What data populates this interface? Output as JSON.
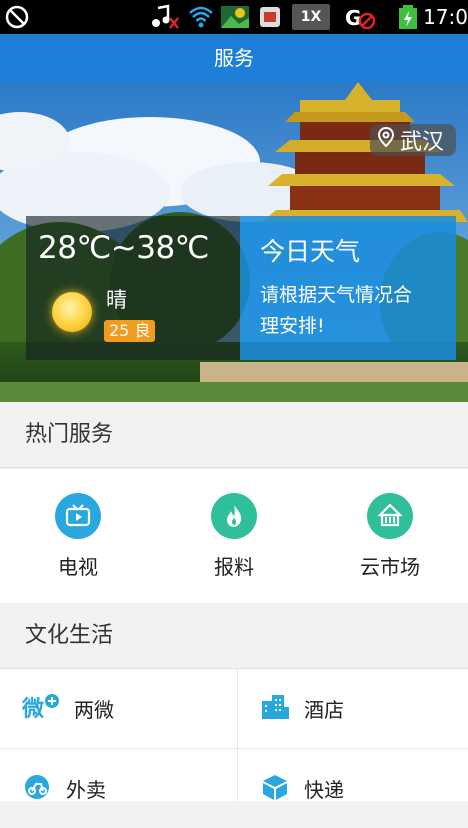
{
  "status_bar": {
    "time": "17:0",
    "multi_sim_label": "1X"
  },
  "title_bar": {
    "title": "服务"
  },
  "banner": {
    "location": "武汉",
    "weather": {
      "temperature": "28℃~38℃",
      "condition": "晴",
      "aqi": "25 良"
    },
    "today": {
      "title": "今日天气",
      "text_line1": "请根据天气情况合",
      "text_line2": "理安排!"
    }
  },
  "hot_services": {
    "heading": "热门服务",
    "items": [
      {
        "label": "电视",
        "icon": "tv-icon",
        "color": "#29a8e0"
      },
      {
        "label": "报料",
        "icon": "flame-icon",
        "color": "#2fbf9a"
      },
      {
        "label": "云市场",
        "icon": "market-icon",
        "color": "#2fbf9a"
      }
    ]
  },
  "culture_life": {
    "heading": "文化生活",
    "items": [
      {
        "label": "两微",
        "icon": "weibo-plus-icon"
      },
      {
        "label": "酒店",
        "icon": "hotel-building-icon"
      },
      {
        "label": "外卖",
        "icon": "delivery-scooter-icon"
      },
      {
        "label": "快递",
        "icon": "package-box-icon"
      }
    ]
  },
  "colors": {
    "primary": "#1e7fd9",
    "accent_teal": "#2fbf9a",
    "accent_blue": "#29a8e0",
    "aqi": "#f29b1e"
  }
}
